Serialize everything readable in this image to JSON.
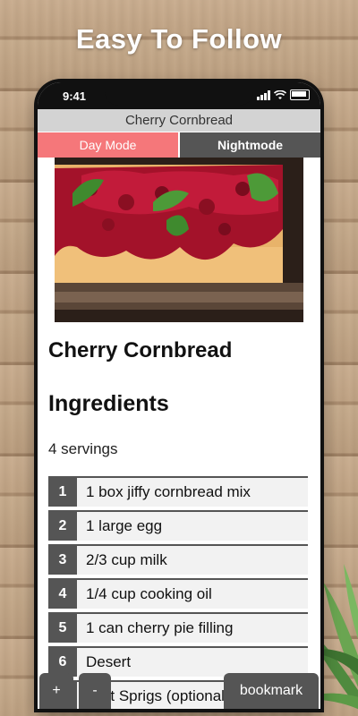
{
  "promo": {
    "headline": "Easy To Follow"
  },
  "status": {
    "time": "9:41"
  },
  "app": {
    "title": "Cherry Cornbread",
    "modes": {
      "day": "Day Mode",
      "night": "Nightmode"
    }
  },
  "recipe": {
    "name": "Cherry Cornbread",
    "ingredients_heading": "Ingredients",
    "servings": "4 servings",
    "ingredients": [
      {
        "num": "1",
        "text": "1 box jiffy cornbread mix"
      },
      {
        "num": "2",
        "text": "1 large egg"
      },
      {
        "num": "3",
        "text": "2/3 cup milk"
      },
      {
        "num": "4",
        "text": "1/4 cup cooking oil"
      },
      {
        "num": "5",
        "text": "1 can cherry pie filling"
      },
      {
        "num": "6",
        "text": "Desert"
      },
      {
        "num": "7",
        "text": "Mint Sprigs (optional)"
      }
    ]
  },
  "controls": {
    "plus": "+",
    "minus": "-",
    "bookmark": "bookmark"
  },
  "colors": {
    "day_mode": "#f5777a",
    "dark": "#555555",
    "titlebar": "#d3d3d3"
  }
}
